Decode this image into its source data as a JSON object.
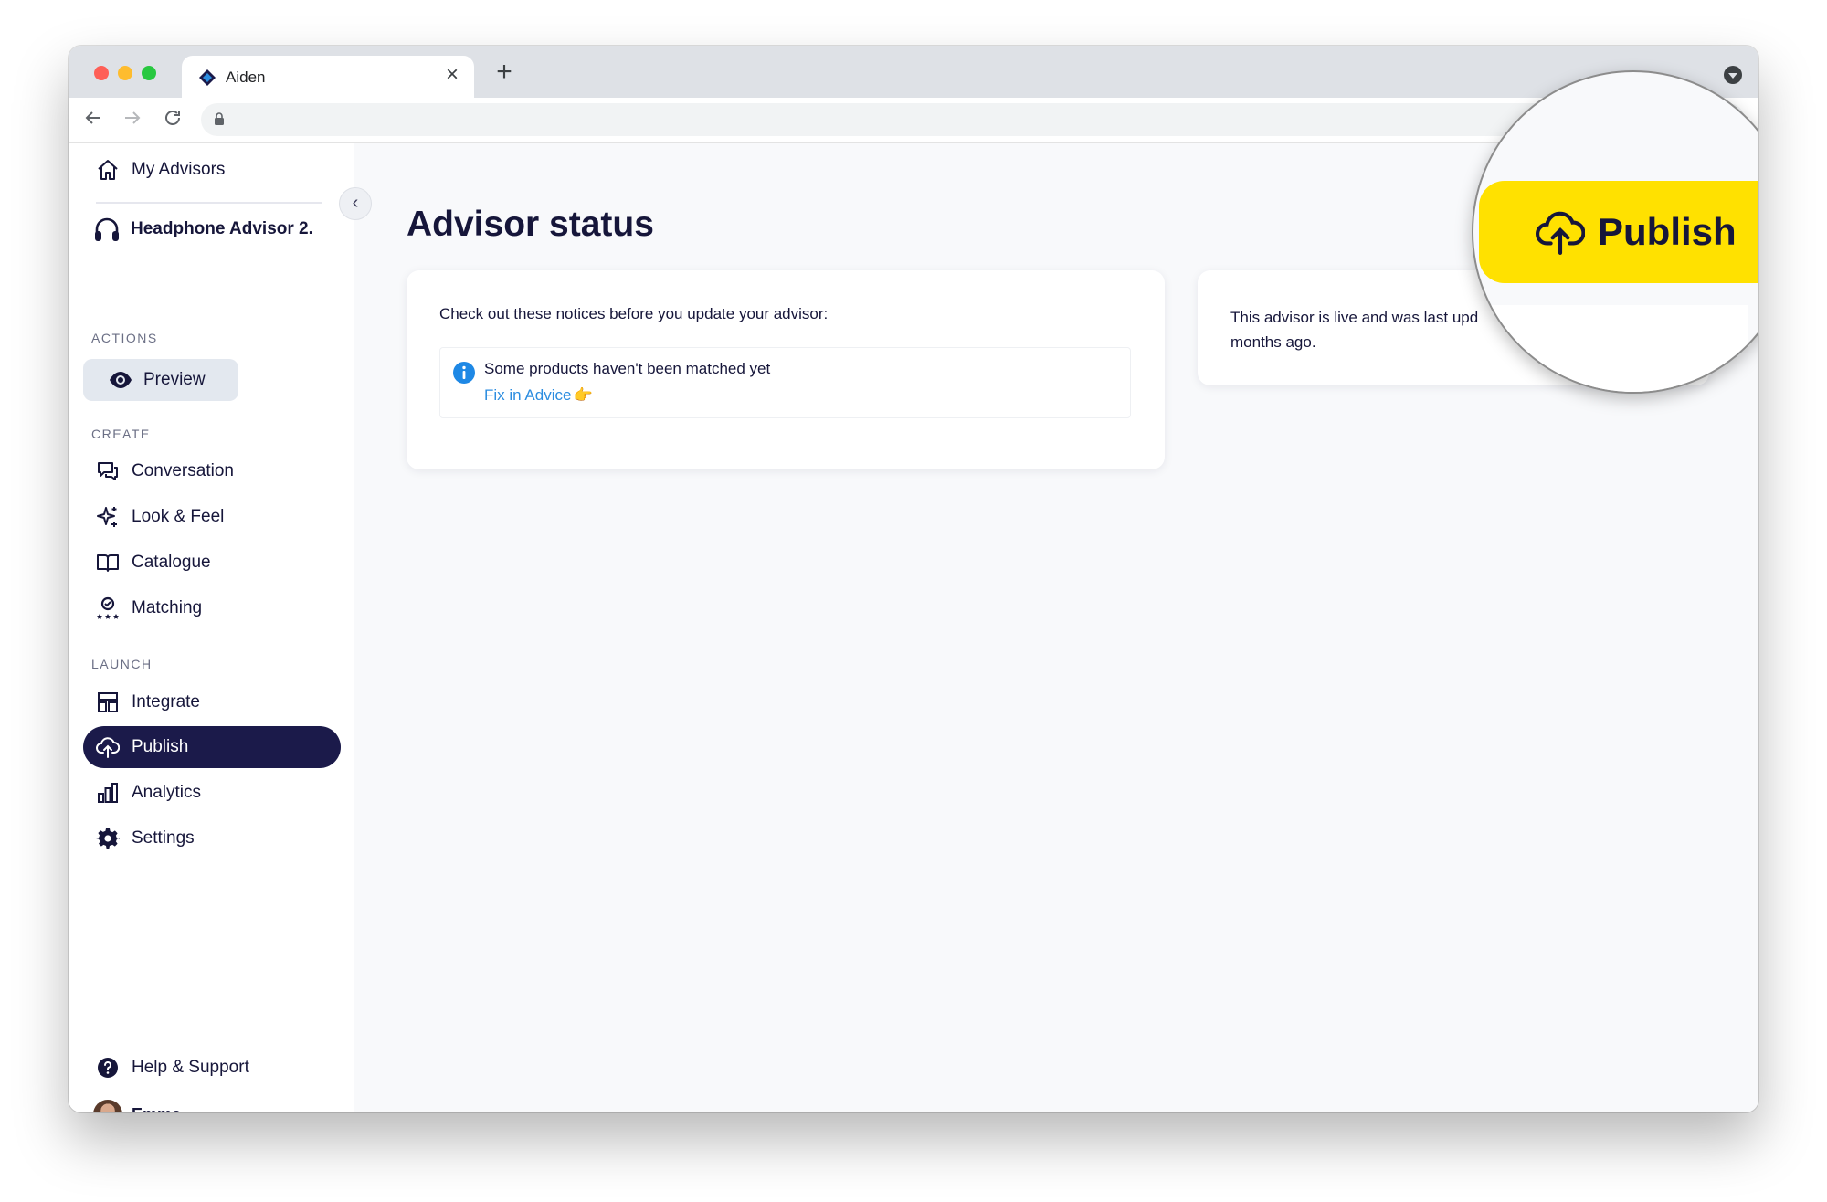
{
  "browser": {
    "tab_title": "Aiden",
    "tab_close": "×",
    "new_tab": "+"
  },
  "sidebar": {
    "my_advisors": "My Advisors",
    "advisor_name": "Headphone Advisor 2.",
    "collapse": "‹",
    "actions_label": "ACTIONS",
    "preview": "Preview",
    "create_label": "CREATE",
    "create_items": [
      {
        "label": "Conversation",
        "icon": "chat-bubbles-icon"
      },
      {
        "label": "Look & Feel",
        "icon": "sparkles-icon"
      },
      {
        "label": "Catalogue",
        "icon": "book-open-icon"
      },
      {
        "label": "Matching",
        "icon": "award-stars-icon"
      }
    ],
    "launch_label": "LAUNCH",
    "launch_items": [
      {
        "label": "Integrate",
        "icon": "layout-icon"
      },
      {
        "label": "Publish",
        "icon": "cloud-upload-icon",
        "active": true
      },
      {
        "label": "Analytics",
        "icon": "bar-chart-icon"
      },
      {
        "label": "Settings",
        "icon": "gear-icon"
      }
    ],
    "help": "Help & Support",
    "user": "Emma"
  },
  "main": {
    "title": "Advisor status",
    "notices_intro": "Check out these notices before you update your advisor:",
    "notice_text": "Some products haven't been matched yet",
    "notice_link": "Fix in Advice",
    "notice_emoji": "👉",
    "status_text": "This advisor is live and was last upd months ago."
  },
  "magnifier": {
    "publish_label": "Publish"
  },
  "colors": {
    "navy": "#1b1a4a",
    "publish_yellow": "#ffe100",
    "link_blue": "#2c8de0",
    "info_blue": "#1e88e5"
  }
}
